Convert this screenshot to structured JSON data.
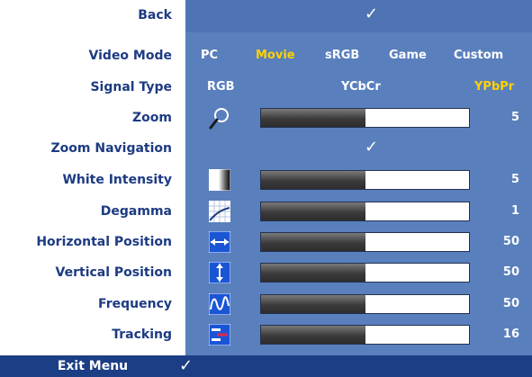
{
  "menu": {
    "back": {
      "label": "Back",
      "value": "✓"
    },
    "video_mode": {
      "label": "Video Mode",
      "options": [
        "PC",
        "Movie",
        "sRGB",
        "Game",
        "Custom"
      ],
      "selected": "Movie"
    },
    "signal_type": {
      "label": "Signal Type",
      "options": [
        "RGB",
        "YCbCr",
        "YPbPr"
      ],
      "selected": "YPbPr"
    },
    "zoom": {
      "label": "Zoom",
      "icon": "magnifier-icon",
      "level": 0.5,
      "value": "5"
    },
    "zoom_navigation": {
      "label": "Zoom Navigation",
      "value": "✓"
    },
    "white_intensity": {
      "label": "White Intensity",
      "icon": "gradient-icon",
      "level": 0.5,
      "value": "5"
    },
    "degamma": {
      "label": "Degamma",
      "icon": "curve-icon",
      "level": 0.5,
      "value": "1"
    },
    "horizontal_position": {
      "label": "Horizontal Position",
      "icon": "horizontal-arrows-icon",
      "level": 0.5,
      "value": "50"
    },
    "vertical_position": {
      "label": "Vertical Position",
      "icon": "vertical-arrows-icon",
      "level": 0.5,
      "value": "50"
    },
    "frequency": {
      "label": "Frequency",
      "icon": "waveform-icon",
      "level": 0.5,
      "value": "50"
    },
    "tracking": {
      "label": "Tracking",
      "icon": "tracking-icon",
      "level": 0.5,
      "value": "16"
    },
    "exit": {
      "label": "Exit Menu",
      "value": "✓"
    }
  },
  "colors": {
    "label_text": "#1d3b82",
    "panel": "#5a7fbd",
    "exit_bar": "#1c3e84",
    "selected_option": "#ffd200"
  }
}
